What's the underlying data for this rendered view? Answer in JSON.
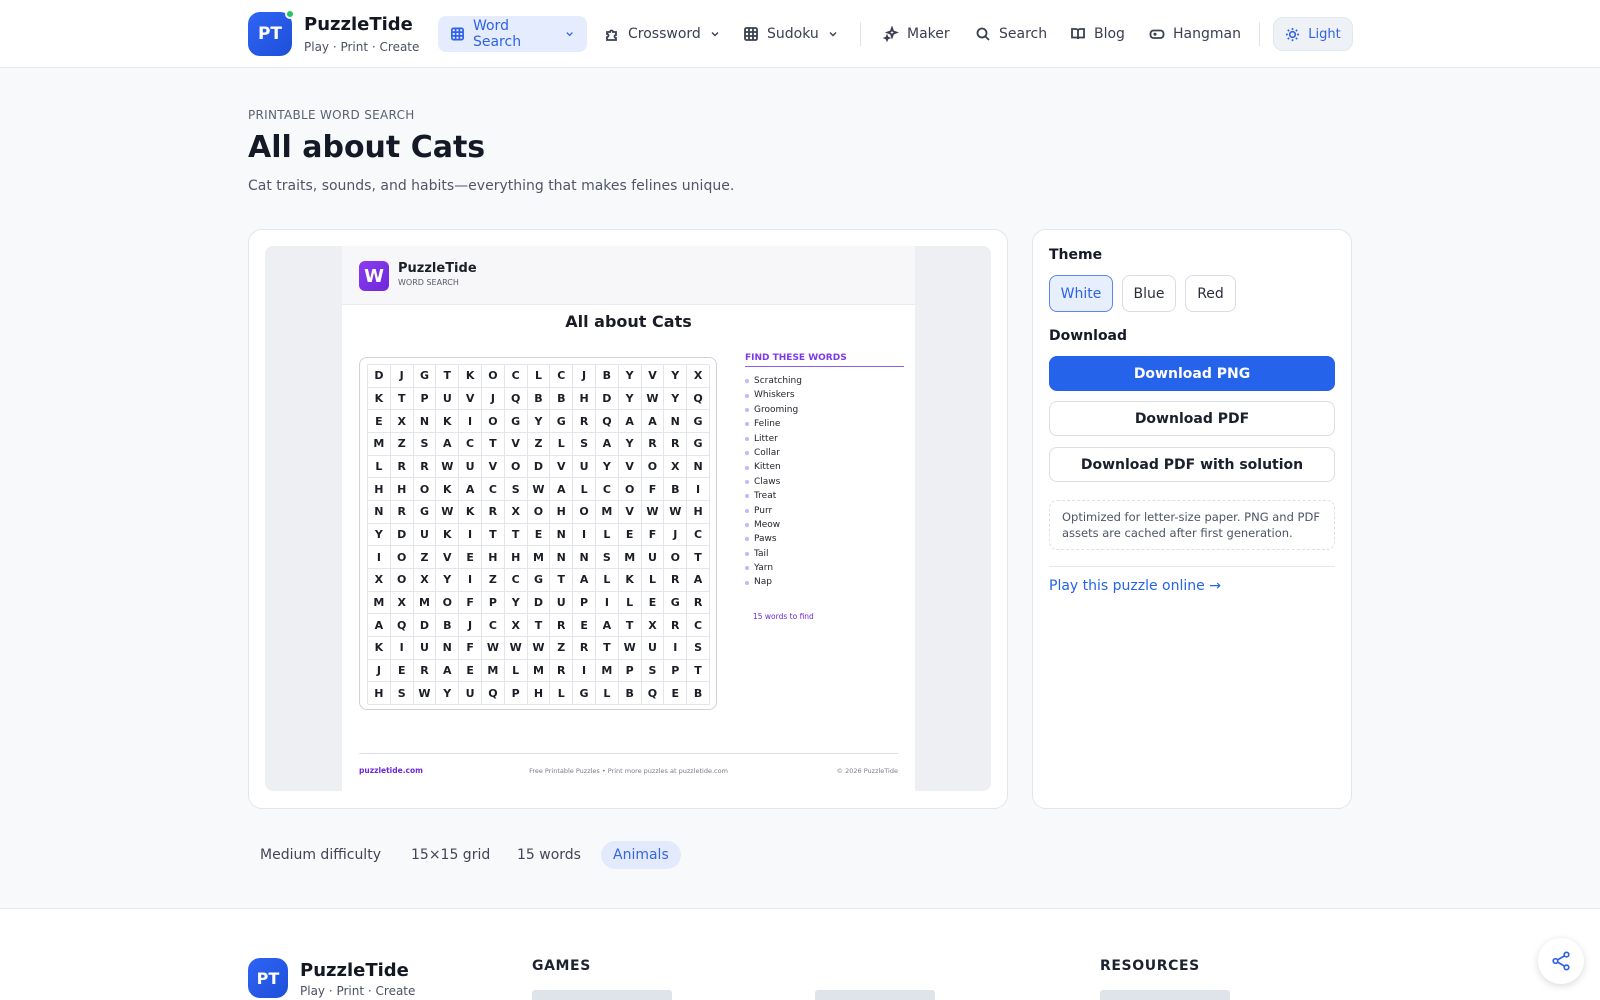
{
  "header": {
    "logo_initials": "PT",
    "brand": "PuzzleTide",
    "tagline": "Play · Print · Create",
    "nav": [
      {
        "label": "Word Search",
        "icon": "grid-icon",
        "dropdown": true,
        "active": true
      },
      {
        "label": "Crossword",
        "icon": "puzzle-icon",
        "dropdown": true
      },
      {
        "label": "Sudoku",
        "icon": "grid-icon",
        "dropdown": true
      },
      {
        "label": "Maker",
        "icon": "sparkles-icon"
      },
      {
        "label": "Search",
        "icon": "search-icon"
      },
      {
        "label": "Blog",
        "icon": "book-icon"
      },
      {
        "label": "Hangman",
        "icon": "gamepad-icon"
      }
    ],
    "theme_toggle": "Light"
  },
  "page": {
    "eyebrow": "PRINTABLE WORD SEARCH",
    "title": "All about Cats",
    "subtitle": "Cat traits, sounds, and habits—everything that makes felines unique."
  },
  "sheet": {
    "logo_letter": "W",
    "brand": "PuzzleTide",
    "brand_sub": "WORD SEARCH",
    "title": "All about Cats",
    "grid": [
      "DJGTKOCLCJBYVYX",
      "KTPUVJQBBHDYWYQ",
      "EXNKIOGYGRQAANG",
      "MZSACTVZLSAYRRG",
      "LRRWUVODVUYVOXN",
      "HHOKACSWALCOFBI",
      "NRGWKRXOHOMVWWH",
      "YDUKITTENILEFJC",
      "IOZVEHHMNNSMUOT",
      "XOXYIZCGTALKLRA",
      "MXMOFPYDUPILEGR",
      "AQDBJCXTREATXRC",
      "KIUNFWWWZRTWUIS",
      "JERAEMLMRIMPSPT",
      "HSWYUQPHLGLBQEB"
    ],
    "find_title": "FIND THESE WORDS",
    "words": [
      "Scratching",
      "Whiskers",
      "Grooming",
      "Feline",
      "Litter",
      "Collar",
      "Kitten",
      "Claws",
      "Treat",
      "Purr",
      "Meow",
      "Paws",
      "Tail",
      "Yarn",
      "Nap"
    ],
    "word_count": "15 words to find",
    "footer_left": "puzzletide.com",
    "footer_mid": "Free Printable Puzzles • Print more puzzles at puzzletide.com",
    "footer_right": "© 2026 PuzzleTide"
  },
  "sidebar": {
    "theme_label": "Theme",
    "themes": [
      "White",
      "Blue",
      "Red"
    ],
    "selected_theme": "White",
    "download_label": "Download",
    "download_png": "Download PNG",
    "download_pdf": "Download PDF",
    "download_pdf_solution": "Download PDF with solution",
    "note": "Optimized for letter-size paper. PNG and PDF assets are cached after first generation.",
    "play_link": "Play this puzzle online →"
  },
  "tags": [
    "Medium difficulty",
    "15×15 grid",
    "15 words",
    "Animals"
  ],
  "footer": {
    "logo_initials": "PT",
    "brand": "PuzzleTide",
    "tagline": "Play · Print · Create",
    "games_heading": "GAMES",
    "resources_heading": "RESOURCES"
  },
  "colors": {
    "accent": "#2563eb",
    "sheet_accent": "#7c3aed",
    "status_online": "#22c55e"
  }
}
